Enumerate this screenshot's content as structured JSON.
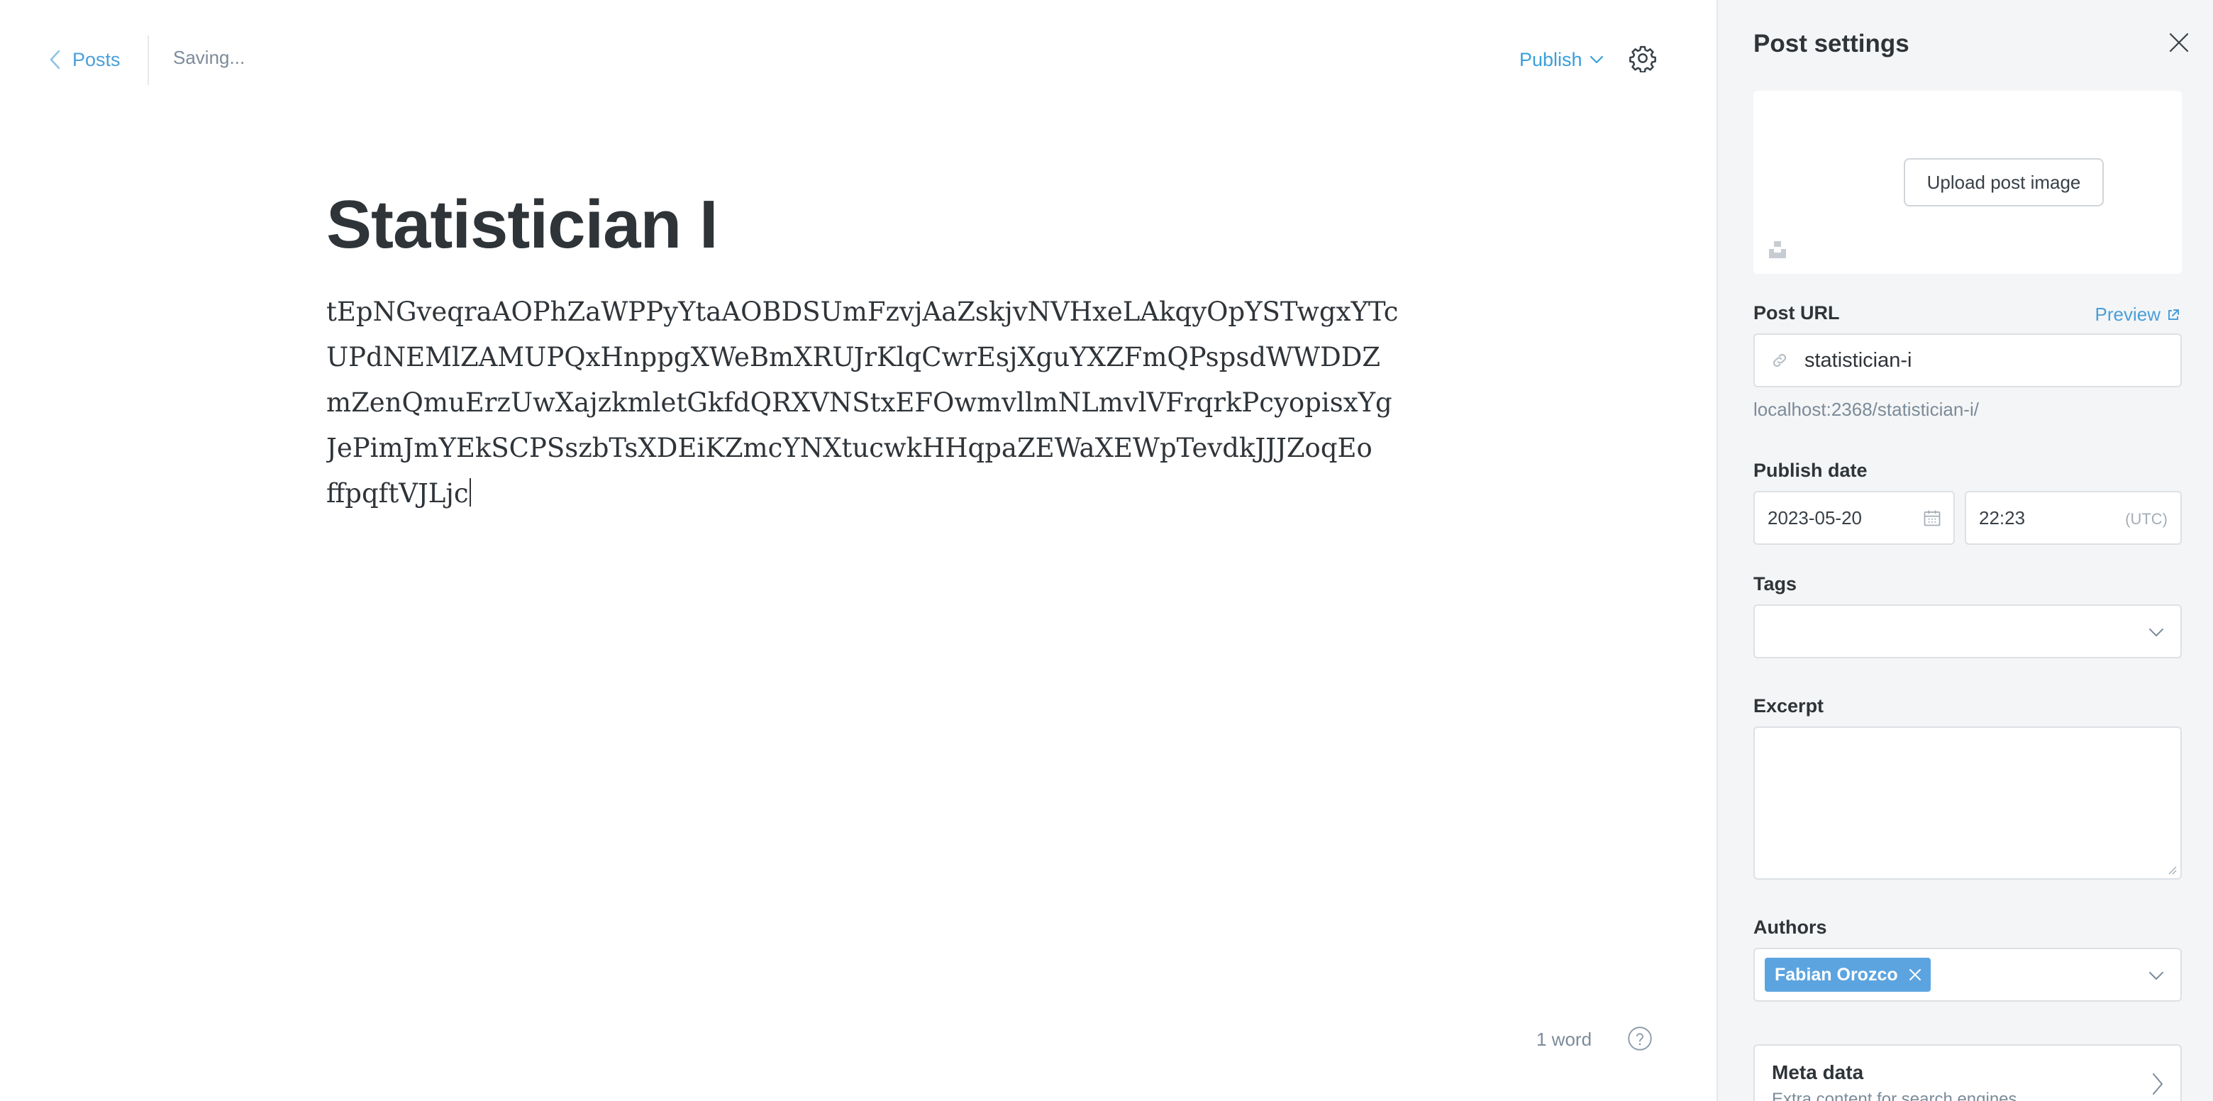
{
  "topbar": {
    "back_label": "Posts",
    "save_status": "Saving...",
    "publish_label": "Publish"
  },
  "editor": {
    "title": "Statistician I",
    "body_lines": [
      "tEpNGveqraAOPhZaWPPyYtaAOBDSUmFzvjAaZskjvNVHxeLAkqyOpYSTwgxYTc",
      "UPdNEMlZAMUPQxHnppgXWeBmXRUJrKlqCwrEsjXguYXZFmQPspsdWWDDZ",
      "mZenQmuErzUwXajzkmletGkfdQRXVNStxEFOwmvllmNLmvlVFrqrkPcyopisxYg",
      "JePimJmYEkSCPSszbTsXDEiKZmcYNXtucwkHHqpaZEWaXEWpTevdkJJJZoqEo",
      "ffpqftVJLjc"
    ],
    "word_count": "1 word"
  },
  "settings": {
    "title": "Post settings",
    "upload_label": "Upload post image",
    "post_url_label": "Post URL",
    "preview_label": "Preview",
    "slug": "statistician-i",
    "full_url": "localhost:2368/statistician-i/",
    "publish_date_label": "Publish date",
    "date": "2023-05-20",
    "time": "22:23",
    "timezone": "(UTC)",
    "tags_label": "Tags",
    "excerpt_label": "Excerpt",
    "authors_label": "Authors",
    "author": "Fabian Orozco",
    "meta_title": "Meta data",
    "meta_subtitle": "Extra content for search engines"
  },
  "colors": {
    "accent": "#4a9fd9",
    "token": "#5ba4e0",
    "panel_bg": "#f4f5f6"
  }
}
